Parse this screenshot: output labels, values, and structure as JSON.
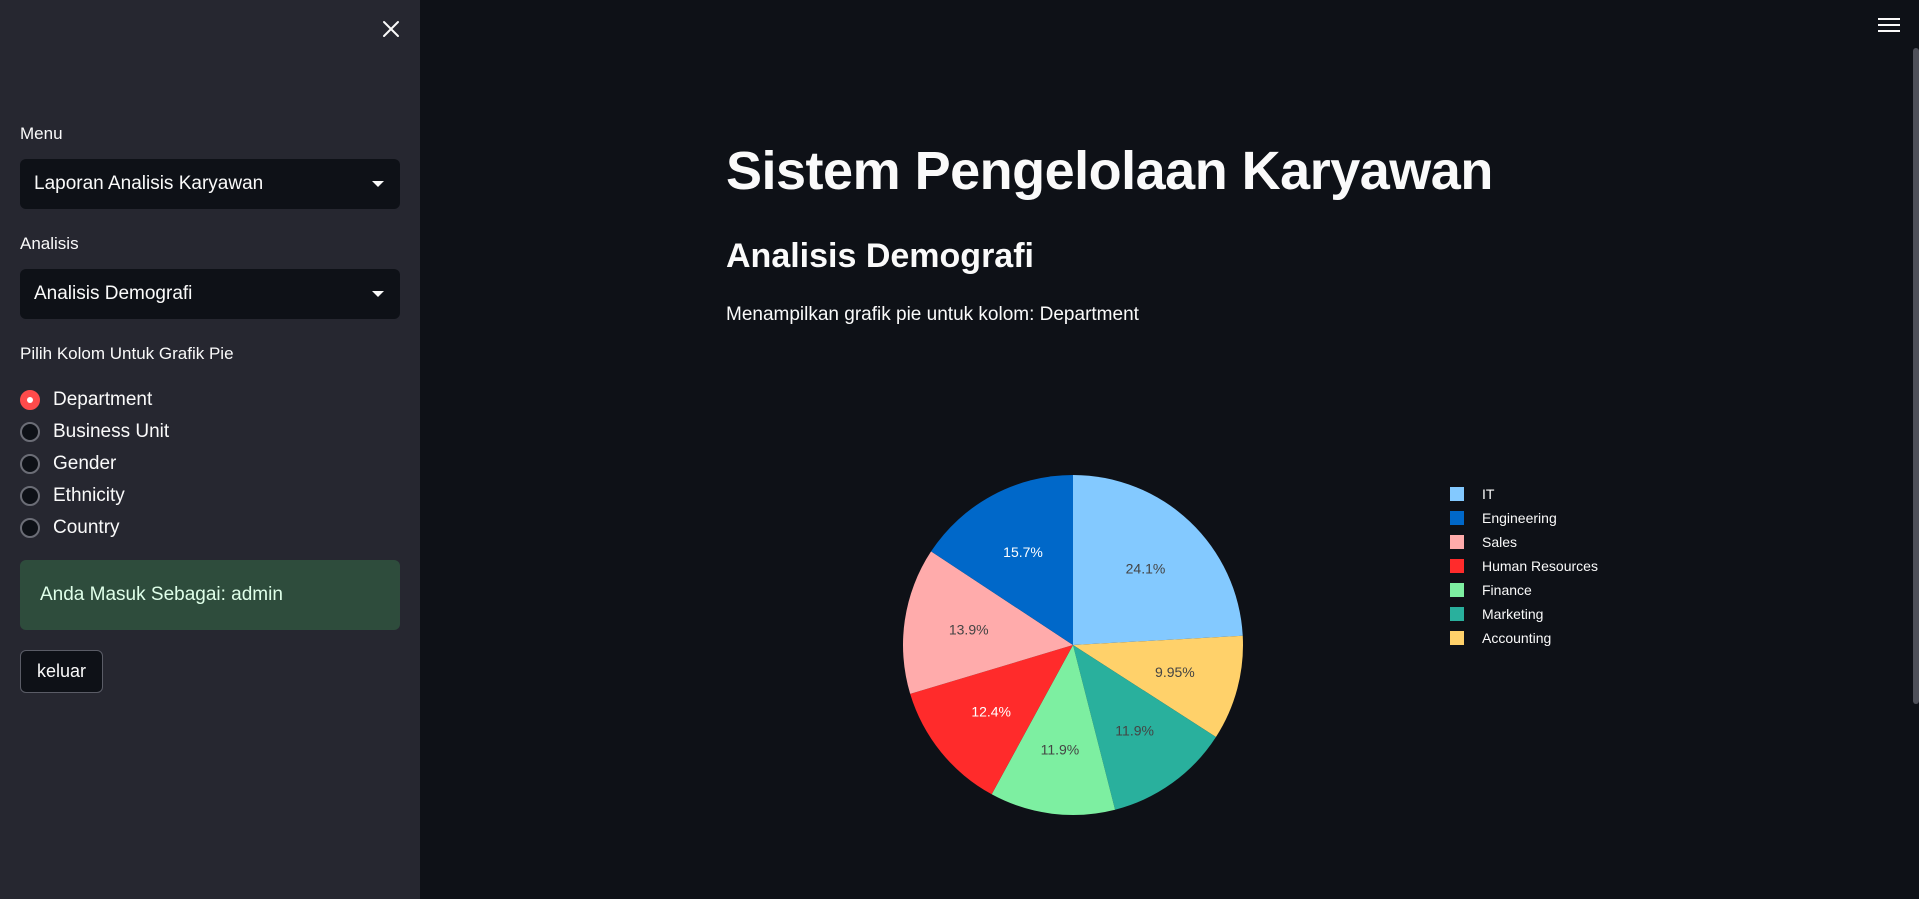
{
  "sidebar": {
    "menu_label": "Menu",
    "menu_value": "Laporan Analisis Karyawan",
    "analysis_label": "Analisis",
    "analysis_value": "Analisis Demografi",
    "radio_label": "Pilih Kolom Untuk Grafik Pie",
    "radio_options": [
      "Department",
      "Business Unit",
      "Gender",
      "Ethnicity",
      "Country"
    ],
    "selected_option": "Department",
    "alert_text": "Anda Masuk Sebagai: admin",
    "logout_label": "keluar"
  },
  "main": {
    "title": "Sistem Pengelolaan Karyawan",
    "subtitle": "Analisis Demografi",
    "description": "Menampilkan grafik pie untuk kolom: Department"
  },
  "colors": {
    "accent": "#ff4b4b",
    "background": "#0e1117",
    "sidebar": "#262730"
  },
  "chart_data": {
    "type": "pie",
    "categories": [
      "IT",
      "Engineering",
      "Sales",
      "Human Resources",
      "Finance",
      "Marketing",
      "Accounting"
    ],
    "values": [
      24.1,
      15.7,
      13.9,
      12.4,
      11.9,
      11.9,
      9.95
    ],
    "labels": [
      "24.1%",
      "15.7%",
      "13.9%",
      "12.4%",
      "11.9%",
      "11.9%",
      "9.95%"
    ],
    "colors": [
      "#83c9ff",
      "#0068c9",
      "#ffabab",
      "#ff2b2b",
      "#7defa1",
      "#29b09d",
      "#ffd16a"
    ],
    "label_colors": [
      "#444444",
      "#ffffff",
      "#444444",
      "#ffffff",
      "#444444",
      "#444444",
      "#444444"
    ],
    "legend_position": "right",
    "direction": "clockwise",
    "slice_order_clockwise_from_top": [
      "IT",
      "Accounting",
      "Marketing",
      "Finance",
      "Human Resources",
      "Sales",
      "Engineering"
    ]
  }
}
